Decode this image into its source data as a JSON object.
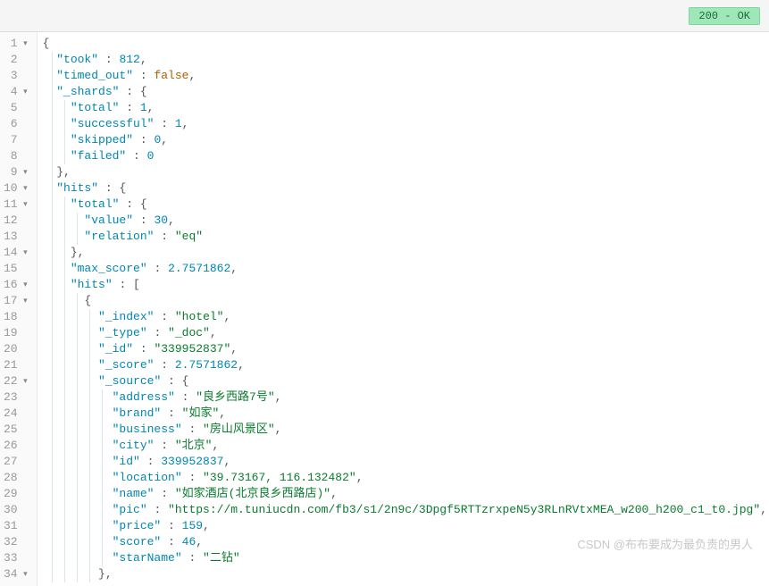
{
  "status": {
    "code": "200",
    "text": "OK",
    "badge": "200 - OK"
  },
  "watermark": "CSDN @布布要成为最负责的男人",
  "lines": [
    {
      "n": 1,
      "fold": true,
      "indent": 0,
      "tokens": [
        [
          "brace",
          "{"
        ]
      ]
    },
    {
      "n": 2,
      "fold": false,
      "indent": 1,
      "tokens": [
        [
          "key",
          "\"took\""
        ],
        [
          "punct",
          " : "
        ],
        [
          "num",
          "812"
        ],
        [
          "punct",
          ","
        ]
      ]
    },
    {
      "n": 3,
      "fold": false,
      "indent": 1,
      "tokens": [
        [
          "key",
          "\"timed_out\""
        ],
        [
          "punct",
          " : "
        ],
        [
          "bool",
          "false"
        ],
        [
          "punct",
          ","
        ]
      ]
    },
    {
      "n": 4,
      "fold": true,
      "indent": 1,
      "tokens": [
        [
          "key",
          "\"_shards\""
        ],
        [
          "punct",
          " : "
        ],
        [
          "brace",
          "{"
        ]
      ]
    },
    {
      "n": 5,
      "fold": false,
      "indent": 2,
      "tokens": [
        [
          "key",
          "\"total\""
        ],
        [
          "punct",
          " : "
        ],
        [
          "num",
          "1"
        ],
        [
          "punct",
          ","
        ]
      ]
    },
    {
      "n": 6,
      "fold": false,
      "indent": 2,
      "tokens": [
        [
          "key",
          "\"successful\""
        ],
        [
          "punct",
          " : "
        ],
        [
          "num",
          "1"
        ],
        [
          "punct",
          ","
        ]
      ]
    },
    {
      "n": 7,
      "fold": false,
      "indent": 2,
      "tokens": [
        [
          "key",
          "\"skipped\""
        ],
        [
          "punct",
          " : "
        ],
        [
          "num",
          "0"
        ],
        [
          "punct",
          ","
        ]
      ]
    },
    {
      "n": 8,
      "fold": false,
      "indent": 2,
      "tokens": [
        [
          "key",
          "\"failed\""
        ],
        [
          "punct",
          " : "
        ],
        [
          "num",
          "0"
        ]
      ]
    },
    {
      "n": 9,
      "fold": true,
      "indent": 1,
      "tokens": [
        [
          "brace",
          "}"
        ],
        [
          "punct",
          ","
        ]
      ]
    },
    {
      "n": 10,
      "fold": true,
      "indent": 1,
      "tokens": [
        [
          "key",
          "\"hits\""
        ],
        [
          "punct",
          " : "
        ],
        [
          "brace",
          "{"
        ]
      ]
    },
    {
      "n": 11,
      "fold": true,
      "indent": 2,
      "tokens": [
        [
          "key",
          "\"total\""
        ],
        [
          "punct",
          " : "
        ],
        [
          "brace",
          "{"
        ]
      ]
    },
    {
      "n": 12,
      "fold": false,
      "indent": 3,
      "tokens": [
        [
          "key",
          "\"value\""
        ],
        [
          "punct",
          " : "
        ],
        [
          "num",
          "30"
        ],
        [
          "punct",
          ","
        ]
      ]
    },
    {
      "n": 13,
      "fold": false,
      "indent": 3,
      "tokens": [
        [
          "key",
          "\"relation\""
        ],
        [
          "punct",
          " : "
        ],
        [
          "str",
          "\"eq\""
        ]
      ]
    },
    {
      "n": 14,
      "fold": true,
      "indent": 2,
      "tokens": [
        [
          "brace",
          "}"
        ],
        [
          "punct",
          ","
        ]
      ]
    },
    {
      "n": 15,
      "fold": false,
      "indent": 2,
      "tokens": [
        [
          "key",
          "\"max_score\""
        ],
        [
          "punct",
          " : "
        ],
        [
          "num",
          "2.7571862"
        ],
        [
          "punct",
          ","
        ]
      ]
    },
    {
      "n": 16,
      "fold": true,
      "indent": 2,
      "tokens": [
        [
          "key",
          "\"hits\""
        ],
        [
          "punct",
          " : "
        ],
        [
          "brace",
          "["
        ]
      ]
    },
    {
      "n": 17,
      "fold": true,
      "indent": 3,
      "tokens": [
        [
          "brace",
          "{"
        ]
      ]
    },
    {
      "n": 18,
      "fold": false,
      "indent": 4,
      "tokens": [
        [
          "key",
          "\"_index\""
        ],
        [
          "punct",
          " : "
        ],
        [
          "str",
          "\"hotel\""
        ],
        [
          "punct",
          ","
        ]
      ]
    },
    {
      "n": 19,
      "fold": false,
      "indent": 4,
      "tokens": [
        [
          "key",
          "\"_type\""
        ],
        [
          "punct",
          " : "
        ],
        [
          "str",
          "\"_doc\""
        ],
        [
          "punct",
          ","
        ]
      ]
    },
    {
      "n": 20,
      "fold": false,
      "indent": 4,
      "tokens": [
        [
          "key",
          "\"_id\""
        ],
        [
          "punct",
          " : "
        ],
        [
          "str",
          "\"339952837\""
        ],
        [
          "punct",
          ","
        ]
      ]
    },
    {
      "n": 21,
      "fold": false,
      "indent": 4,
      "tokens": [
        [
          "key",
          "\"_score\""
        ],
        [
          "punct",
          " : "
        ],
        [
          "num",
          "2.7571862"
        ],
        [
          "punct",
          ","
        ]
      ]
    },
    {
      "n": 22,
      "fold": true,
      "indent": 4,
      "tokens": [
        [
          "key",
          "\"_source\""
        ],
        [
          "punct",
          " : "
        ],
        [
          "brace",
          "{"
        ]
      ]
    },
    {
      "n": 23,
      "fold": false,
      "indent": 5,
      "tokens": [
        [
          "key",
          "\"address\""
        ],
        [
          "punct",
          " : "
        ],
        [
          "str",
          "\"良乡西路7号\""
        ],
        [
          "punct",
          ","
        ]
      ]
    },
    {
      "n": 24,
      "fold": false,
      "indent": 5,
      "tokens": [
        [
          "key",
          "\"brand\""
        ],
        [
          "punct",
          " : "
        ],
        [
          "str",
          "\"如家\""
        ],
        [
          "punct",
          ","
        ]
      ]
    },
    {
      "n": 25,
      "fold": false,
      "indent": 5,
      "tokens": [
        [
          "key",
          "\"business\""
        ],
        [
          "punct",
          " : "
        ],
        [
          "str",
          "\"房山风景区\""
        ],
        [
          "punct",
          ","
        ]
      ]
    },
    {
      "n": 26,
      "fold": false,
      "indent": 5,
      "tokens": [
        [
          "key",
          "\"city\""
        ],
        [
          "punct",
          " : "
        ],
        [
          "str",
          "\"北京\""
        ],
        [
          "punct",
          ","
        ]
      ]
    },
    {
      "n": 27,
      "fold": false,
      "indent": 5,
      "tokens": [
        [
          "key",
          "\"id\""
        ],
        [
          "punct",
          " : "
        ],
        [
          "num",
          "339952837"
        ],
        [
          "punct",
          ","
        ]
      ]
    },
    {
      "n": 28,
      "fold": false,
      "indent": 5,
      "tokens": [
        [
          "key",
          "\"location\""
        ],
        [
          "punct",
          " : "
        ],
        [
          "str",
          "\"39.73167, 116.132482\""
        ],
        [
          "punct",
          ","
        ]
      ]
    },
    {
      "n": 29,
      "fold": false,
      "indent": 5,
      "tokens": [
        [
          "key",
          "\"name\""
        ],
        [
          "punct",
          " : "
        ],
        [
          "str",
          "\"如家酒店(北京良乡西路店)\""
        ],
        [
          "punct",
          ","
        ]
      ]
    },
    {
      "n": 30,
      "fold": false,
      "indent": 5,
      "tokens": [
        [
          "key",
          "\"pic\""
        ],
        [
          "punct",
          " : "
        ],
        [
          "str",
          "\"https://m.tuniucdn.com/fb3/s1/2n9c/3Dpgf5RTTzrxpeN5y3RLnRVtxMEA_w200_h200_c1_t0.jpg\""
        ],
        [
          "punct",
          ","
        ]
      ]
    },
    {
      "n": 31,
      "fold": false,
      "indent": 5,
      "tokens": [
        [
          "key",
          "\"price\""
        ],
        [
          "punct",
          " : "
        ],
        [
          "num",
          "159"
        ],
        [
          "punct",
          ","
        ]
      ]
    },
    {
      "n": 32,
      "fold": false,
      "indent": 5,
      "tokens": [
        [
          "key",
          "\"score\""
        ],
        [
          "punct",
          " : "
        ],
        [
          "num",
          "46"
        ],
        [
          "punct",
          ","
        ]
      ]
    },
    {
      "n": 33,
      "fold": false,
      "indent": 5,
      "tokens": [
        [
          "key",
          "\"starName\""
        ],
        [
          "punct",
          " : "
        ],
        [
          "str",
          "\"二钻\""
        ]
      ]
    },
    {
      "n": 34,
      "fold": true,
      "indent": 4,
      "tokens": [
        [
          "brace",
          "}"
        ],
        [
          "punct",
          ","
        ]
      ]
    }
  ]
}
